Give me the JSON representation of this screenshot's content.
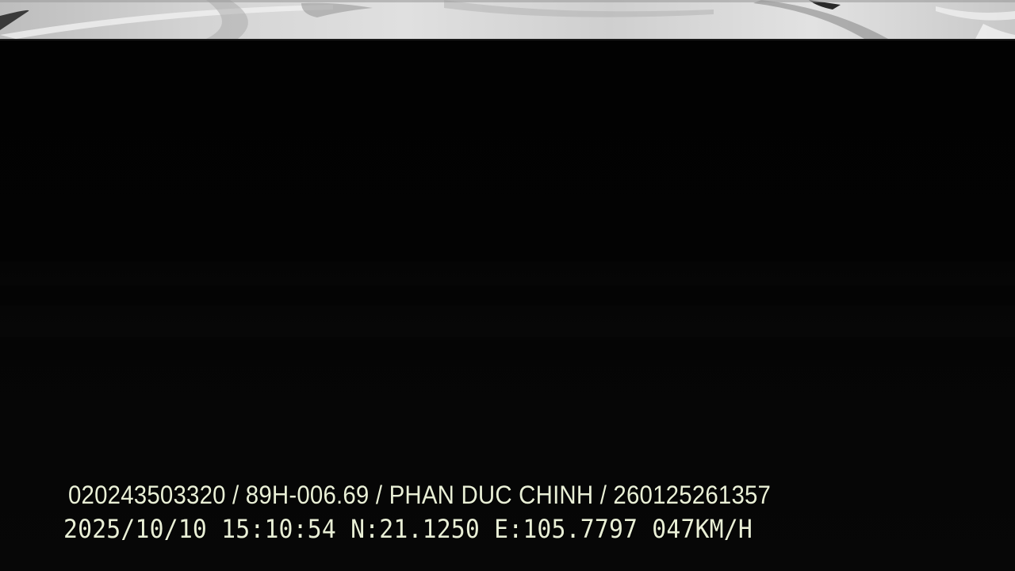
{
  "camera_view": {
    "scene": "dashcam-night-frame"
  },
  "overlay": {
    "device_id": "020243503320",
    "plate": "89H-006.69",
    "driver": "PHAN DUC CHINH",
    "license_no": "260125261357",
    "separator": " / ",
    "date": "2025/10/10",
    "time": "15:10:54",
    "lat": "N:21.1250",
    "lon": "E:105.7797",
    "speed": "047KM/H"
  },
  "colors": {
    "osd_text": "#e9efd6",
    "background": "#030303"
  }
}
